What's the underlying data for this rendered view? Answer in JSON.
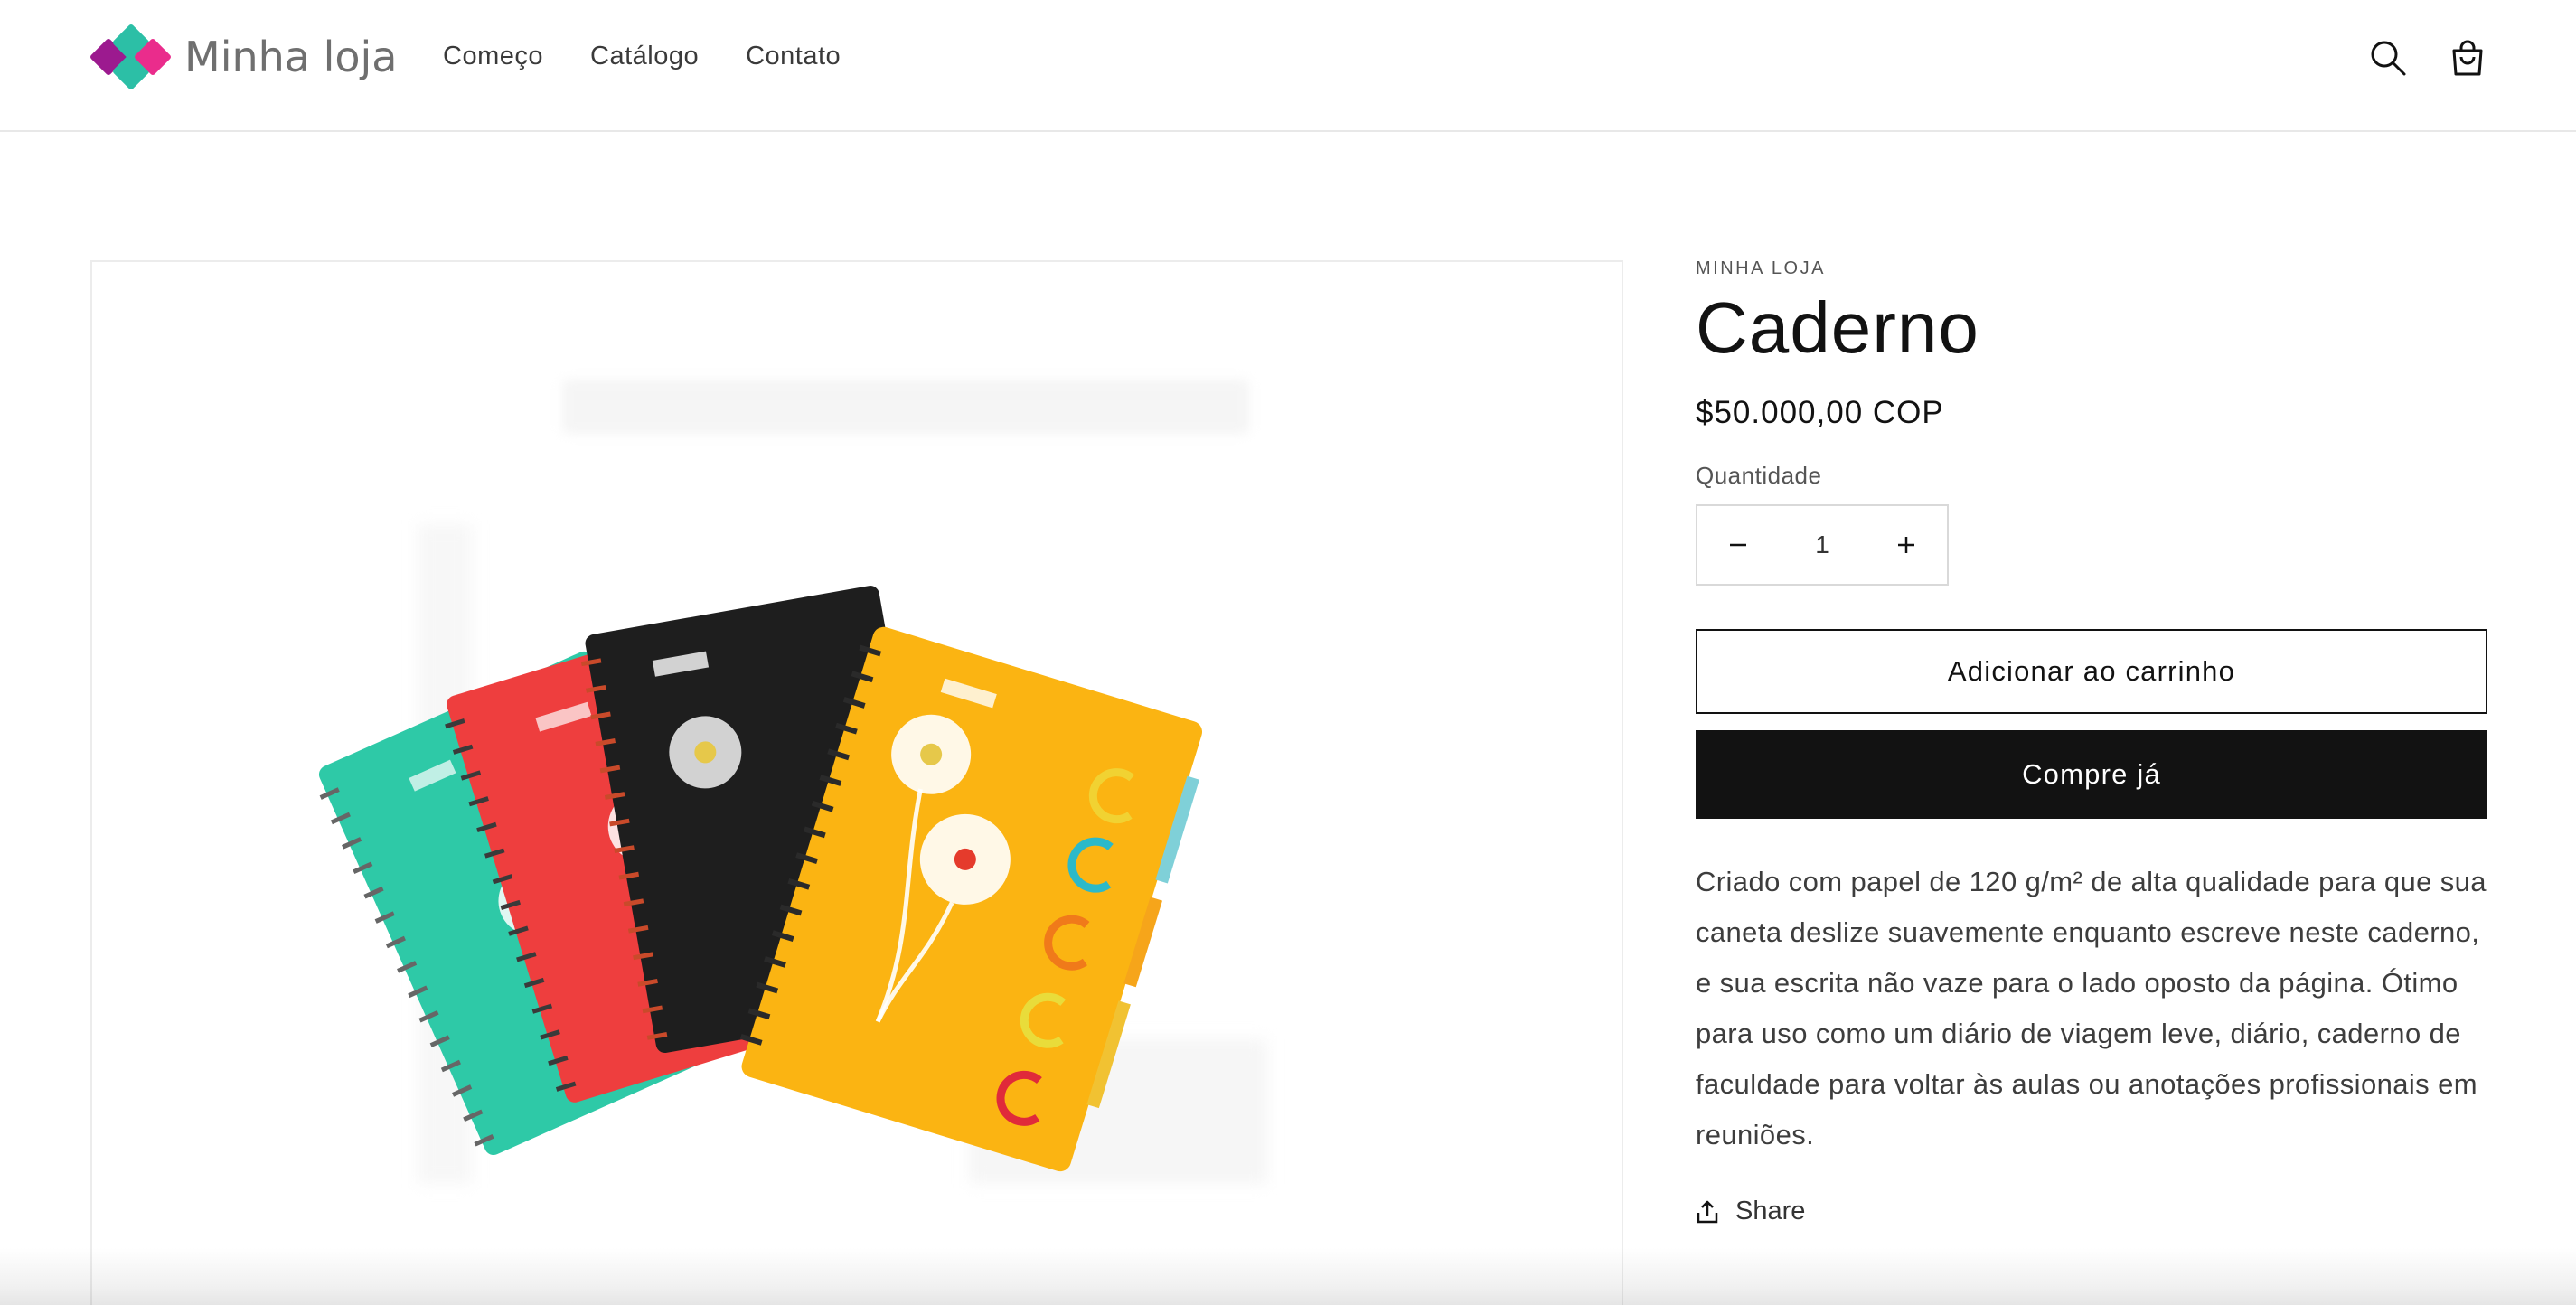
{
  "header": {
    "logo_text": "Minha loja",
    "nav": [
      {
        "label": "Começo"
      },
      {
        "label": "Catálogo"
      },
      {
        "label": "Contato"
      }
    ]
  },
  "product": {
    "vendor": "MINHA LOJA",
    "title": "Caderno",
    "price": "$50.000,00 COP",
    "quantity_label": "Quantidade",
    "quantity_value": "1",
    "add_to_cart_label": "Adicionar ao carrinho",
    "buy_now_label": "Compre já",
    "description": "Criado com papel de 120 g/m² de alta qualidade para que sua caneta deslize suavemente enquanto escreve neste caderno, e sua escrita não vaze para o lado oposto da página. Ótimo para uso como um diário de viagem leve, diário, caderno de faculdade para voltar às aulas ou anotações profissionais em reuniões.",
    "share_label": "Share"
  },
  "colors": {
    "logo_magenta": "#9c1a8f",
    "logo_teal": "#2cbfa6",
    "logo_pink": "#ea2c8c",
    "notebook_teal": "#2ec9a7",
    "notebook_red": "#ee3e3e",
    "notebook_black": "#1e1e1e",
    "notebook_yellow": "#fbb412",
    "button_dark": "#121212"
  }
}
